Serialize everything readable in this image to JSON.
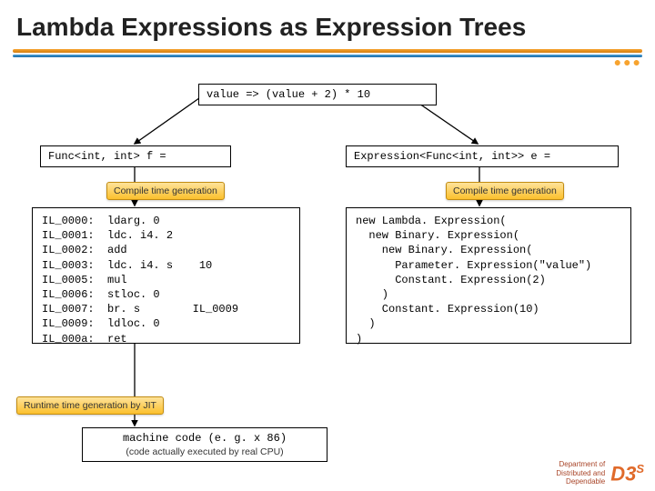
{
  "title": "Lambda Expressions as Expression Trees",
  "lambda": "value => (value + 2) * 10",
  "func_decl": "Func<int, int> f =",
  "expr_decl": "Expression<Func<int, int>> e =",
  "labels": {
    "compile_time": "Compile time generation",
    "runtime_jit": "Runtime time generation by JIT"
  },
  "il_code": "IL_0000:  ldarg. 0\nIL_0001:  ldc. i4. 2\nIL_0002:  add\nIL_0003:  ldc. i4. s    10\nIL_0005:  mul\nIL_0006:  stloc. 0\nIL_0007:  br. s        IL_0009\nIL_0009:  ldloc. 0\nIL_000a:  ret",
  "ast_code": "new Lambda. Expression(\n  new Binary. Expression(\n    new Binary. Expression(\n      Parameter. Expression(\"value\")\n      Constant. Expression(2)\n    )\n    Constant. Expression(10)\n  )\n)",
  "machine": {
    "line": "machine code (e. g. x 86)",
    "caption": "(code actually executed by real CPU)"
  },
  "footer": {
    "dept": "Department of\nDistributed and\nDependable",
    "logo": "D3",
    "logo_sup": "S",
    "copy": ""
  }
}
